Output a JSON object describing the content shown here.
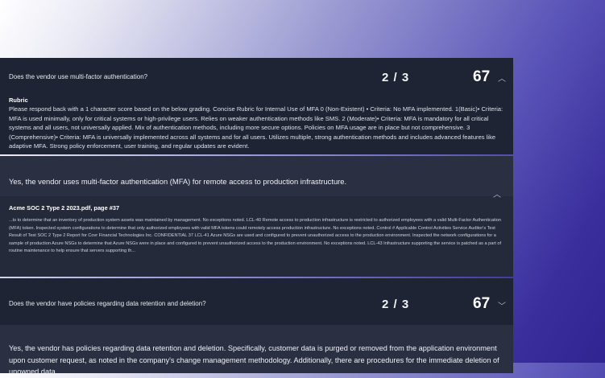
{
  "questions": [
    {
      "text": "Does the vendor use multi-factor authentication?",
      "score": "2 / 3",
      "total": "67",
      "chevron": "chevron-up-icon",
      "rubric_title": "Rubric",
      "rubric_text": "Please respond back with a 1 character score based on the below grading. Concise Rubric for Internal Use of MFA 0 (Non-Existent) • Criteria: No MFA implemented. 1(Basic)• Criteria: MFA is used minimally, only for critical systems or high-privilege users. Relies on weaker authentication methods like SMS. 2 (Moderate)• Criteria: MFA is mandatory for all critical systems and all users, not universally applied. Mix of authentication methods, including more secure options. Policies on MFA usage are in place but not comprehensive. 3 (Comprehensive)• Criteria: MFA is universally implemented across all systems and for all users. Utilizes multiple, strong authentication methods and includes advanced features like adaptive MFA. Strong policy enforcement, user training, and regular updates are evident.",
      "response": "Yes, the vendor uses multi-factor authentication (MFA) for remote access to production infrastructure.",
      "response_chevron": "chevron-up-icon",
      "source_title": "Acme SOC 2 Type 2 2023.pdf, page #37",
      "source_text": "...ts to determine that an inventory of production system assets was maintained by management. No exceptions noted. LCL-40 Remote access to production infrastructure is restricted to authorized employees with a valid Multi-Factor Authentication (MFA) token. Inspected system configurations to determine that only authorized employees with valid MFA tokens could remotely access production infrastructure. No exceptions noted. Control # Applicable Control Activities Service Auditor's Test Result of Test SOC 2 Type 2 Report for Covr Financial Technologies Inc. CONFIDENTIAL 37 LCL-41 Azure NSGs are used and configured to prevent unauthorized access to the production environment. Inspected the network configurations for a sample of production Azure NSGs to determine that Azure NSGs were in place and configured to prevent unauthorized access to the production environment. No exceptions noted. LCL-43 Infrastructure supporting the service is patched as a part of routine maintenance to help ensure that servers supporting th..."
    },
    {
      "text": "Does the vendor have policies regarding data retention and deletion?",
      "score": "2 / 3",
      "total": "67",
      "chevron": "chevron-down-icon",
      "response": "Yes, the vendor has policies regarding data retention and deletion. Specifically, customer data is purged or removed from the application environment upon customer request, as noted in the company's change management methodology. Additionally, there are procedures for the immediate deletion of unowned data"
    }
  ]
}
